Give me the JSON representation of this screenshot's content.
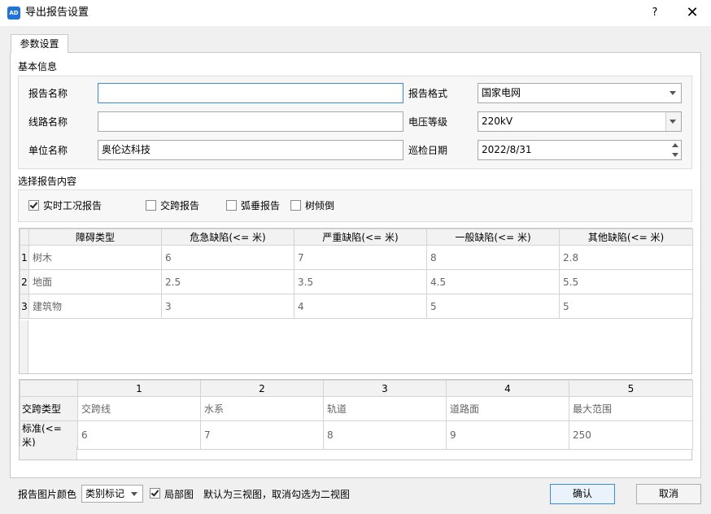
{
  "window": {
    "title": "导出报告设置",
    "help": "?",
    "close": "✕"
  },
  "tab": {
    "label": "参数设置"
  },
  "basic": {
    "title": "基本信息",
    "report_name": {
      "label": "报告名称",
      "value": ""
    },
    "line_name": {
      "label": "线路名称",
      "value": ""
    },
    "unit_name": {
      "label": "单位名称",
      "value": "奥伦达科技"
    },
    "report_format": {
      "label": "报告格式",
      "value": "国家电网"
    },
    "voltage": {
      "label": "电压等级",
      "value": "220kV"
    },
    "inspect_date": {
      "label": "巡检日期",
      "value": "2022/8/31"
    }
  },
  "content": {
    "title": "选择报告内容",
    "options": [
      {
        "label": "实时工况报告",
        "checked": true
      },
      {
        "label": "交跨报告",
        "checked": false
      },
      {
        "label": "弧垂报告",
        "checked": false
      },
      {
        "label": "树倾倒",
        "checked": false
      }
    ]
  },
  "defect_table": {
    "headers": [
      "障碍类型",
      "危急缺陷(<= 米)",
      "严重缺陷(<= 米)",
      "一般缺陷(<= 米)",
      "其他缺陷(<= 米)"
    ],
    "rows": [
      {
        "num": "1",
        "cells": [
          "树木",
          "6",
          "7",
          "8",
          "2.8"
        ]
      },
      {
        "num": "2",
        "cells": [
          "地面",
          "2.5",
          "3.5",
          "4.5",
          "5.5"
        ]
      },
      {
        "num": "3",
        "cells": [
          "建筑物",
          "3",
          "4",
          "5",
          "5"
        ]
      }
    ]
  },
  "cross_table": {
    "headers": [
      "1",
      "2",
      "3",
      "4",
      "5"
    ],
    "rows": [
      {
        "label": "交跨类型",
        "cells": [
          "交跨线",
          "水系",
          "轨道",
          "道路面",
          "最大范围"
        ]
      },
      {
        "label": "标准(<= 米)",
        "cells": [
          "6",
          "7",
          "8",
          "9",
          "250"
        ]
      }
    ]
  },
  "footer": {
    "color_label": "报告图片颜色",
    "color_value": "类别标记",
    "partial_label": "局部图",
    "partial_checked": true,
    "hint": "默认为三视图，取消勾选为二视图",
    "ok": "确认",
    "cancel": "取消"
  },
  "colors": {
    "accent": "#3c8ad8",
    "app_icon": "#1f74d6"
  }
}
